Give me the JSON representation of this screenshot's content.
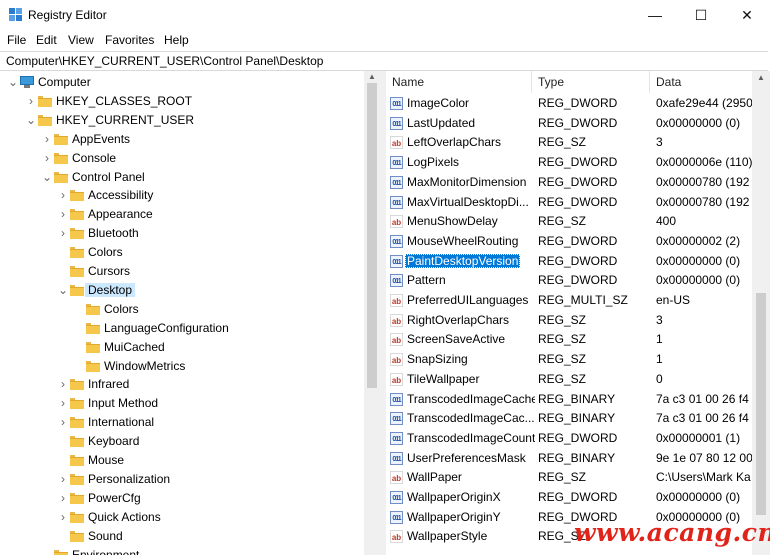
{
  "window": {
    "title": "Registry Editor",
    "minimize_glyph": "—",
    "maximize_glyph": "☐",
    "close_glyph": "✕"
  },
  "menu": [
    "File",
    "Edit",
    "View",
    "Favorites",
    "Help"
  ],
  "address": "Computer\\HKEY_CURRENT_USER\\Control Panel\\Desktop",
  "tree": [
    {
      "label": "Computer",
      "level": 0,
      "arrow": "v",
      "icon": "computer-icon"
    },
    {
      "label": "HKEY_CLASSES_ROOT",
      "level": 1,
      "arrow": ">",
      "icon": "folder-icon"
    },
    {
      "label": "HKEY_CURRENT_USER",
      "level": 1,
      "arrow": "v",
      "icon": "folder-icon"
    },
    {
      "label": "AppEvents",
      "level": 2,
      "arrow": ">",
      "icon": "folder-icon"
    },
    {
      "label": "Console",
      "level": 2,
      "arrow": ">",
      "icon": "folder-icon"
    },
    {
      "label": "Control Panel",
      "level": 2,
      "arrow": "v",
      "icon": "folder-icon"
    },
    {
      "label": "Accessibility",
      "level": 3,
      "arrow": ">",
      "icon": "folder-icon"
    },
    {
      "label": "Appearance",
      "level": 3,
      "arrow": ">",
      "icon": "folder-icon"
    },
    {
      "label": "Bluetooth",
      "level": 3,
      "arrow": ">",
      "icon": "folder-icon"
    },
    {
      "label": "Colors",
      "level": 3,
      "arrow": "",
      "icon": "folder-icon"
    },
    {
      "label": "Cursors",
      "level": 3,
      "arrow": "",
      "icon": "folder-icon"
    },
    {
      "label": "Desktop",
      "level": 3,
      "arrow": "v",
      "icon": "folder-icon",
      "selected": true
    },
    {
      "label": "Colors",
      "level": 4,
      "arrow": "",
      "icon": "folder-icon"
    },
    {
      "label": "LanguageConfiguration",
      "level": 4,
      "arrow": "",
      "icon": "folder-icon"
    },
    {
      "label": "MuiCached",
      "level": 4,
      "arrow": "",
      "icon": "folder-icon"
    },
    {
      "label": "WindowMetrics",
      "level": 4,
      "arrow": "",
      "icon": "folder-icon"
    },
    {
      "label": "Infrared",
      "level": 3,
      "arrow": ">",
      "icon": "folder-icon"
    },
    {
      "label": "Input Method",
      "level": 3,
      "arrow": ">",
      "icon": "folder-icon"
    },
    {
      "label": "International",
      "level": 3,
      "arrow": ">",
      "icon": "folder-icon"
    },
    {
      "label": "Keyboard",
      "level": 3,
      "arrow": "",
      "icon": "folder-icon"
    },
    {
      "label": "Mouse",
      "level": 3,
      "arrow": "",
      "icon": "folder-icon"
    },
    {
      "label": "Personalization",
      "level": 3,
      "arrow": ">",
      "icon": "folder-icon"
    },
    {
      "label": "PowerCfg",
      "level": 3,
      "arrow": ">",
      "icon": "folder-icon"
    },
    {
      "label": "Quick Actions",
      "level": 3,
      "arrow": ">",
      "icon": "folder-icon"
    },
    {
      "label": "Sound",
      "level": 3,
      "arrow": "",
      "icon": "folder-icon"
    },
    {
      "label": "Environment",
      "level": 2,
      "arrow": "",
      "icon": "folder-icon"
    }
  ],
  "list": {
    "columns": [
      "Name",
      "Type",
      "Data"
    ],
    "rows": [
      {
        "name": "ImageColor",
        "type": "REG_DWORD",
        "data": "0xafe29e44 (2950",
        "kind": "bin"
      },
      {
        "name": "LastUpdated",
        "type": "REG_DWORD",
        "data": "0x00000000 (0)",
        "kind": "bin"
      },
      {
        "name": "LeftOverlapChars",
        "type": "REG_SZ",
        "data": "3",
        "kind": "str"
      },
      {
        "name": "LogPixels",
        "type": "REG_DWORD",
        "data": "0x0000006e (110)",
        "kind": "bin"
      },
      {
        "name": "MaxMonitorDimension",
        "type": "REG_DWORD",
        "data": "0x00000780 (192",
        "kind": "bin"
      },
      {
        "name": "MaxVirtualDesktopDi...",
        "type": "REG_DWORD",
        "data": "0x00000780 (192",
        "kind": "bin"
      },
      {
        "name": "MenuShowDelay",
        "type": "REG_SZ",
        "data": "400",
        "kind": "str"
      },
      {
        "name": "MouseWheelRouting",
        "type": "REG_DWORD",
        "data": "0x00000002 (2)",
        "kind": "bin"
      },
      {
        "name": "PaintDesktopVersion",
        "type": "REG_DWORD",
        "data": "0x00000000 (0)",
        "kind": "bin",
        "selected": true
      },
      {
        "name": "Pattern",
        "type": "REG_DWORD",
        "data": "0x00000000 (0)",
        "kind": "bin"
      },
      {
        "name": "PreferredUILanguages",
        "type": "REG_MULTI_SZ",
        "data": "en-US",
        "kind": "str"
      },
      {
        "name": "RightOverlapChars",
        "type": "REG_SZ",
        "data": "3",
        "kind": "str"
      },
      {
        "name": "ScreenSaveActive",
        "type": "REG_SZ",
        "data": "1",
        "kind": "str"
      },
      {
        "name": "SnapSizing",
        "type": "REG_SZ",
        "data": "1",
        "kind": "str"
      },
      {
        "name": "TileWallpaper",
        "type": "REG_SZ",
        "data": "0",
        "kind": "str"
      },
      {
        "name": "TranscodedImageCache",
        "type": "REG_BINARY",
        "data": "7a c3 01 00 26 f4",
        "kind": "bin"
      },
      {
        "name": "TranscodedImageCac...",
        "type": "REG_BINARY",
        "data": "7a c3 01 00 26 f4",
        "kind": "bin"
      },
      {
        "name": "TranscodedImageCount",
        "type": "REG_DWORD",
        "data": "0x00000001 (1)",
        "kind": "bin"
      },
      {
        "name": "UserPreferencesMask",
        "type": "REG_BINARY",
        "data": "9e 1e 07 80 12 00",
        "kind": "bin"
      },
      {
        "name": "WallPaper",
        "type": "REG_SZ",
        "data": "C:\\Users\\Mark Ka",
        "kind": "str"
      },
      {
        "name": "WallpaperOriginX",
        "type": "REG_DWORD",
        "data": "0x00000000 (0)",
        "kind": "bin"
      },
      {
        "name": "WallpaperOriginY",
        "type": "REG_DWORD",
        "data": "0x00000000 (0)",
        "kind": "bin"
      },
      {
        "name": "WallpaperStyle",
        "type": "REG_SZ",
        "data": "",
        "kind": "str"
      }
    ]
  },
  "watermark": "www.acang.cn"
}
